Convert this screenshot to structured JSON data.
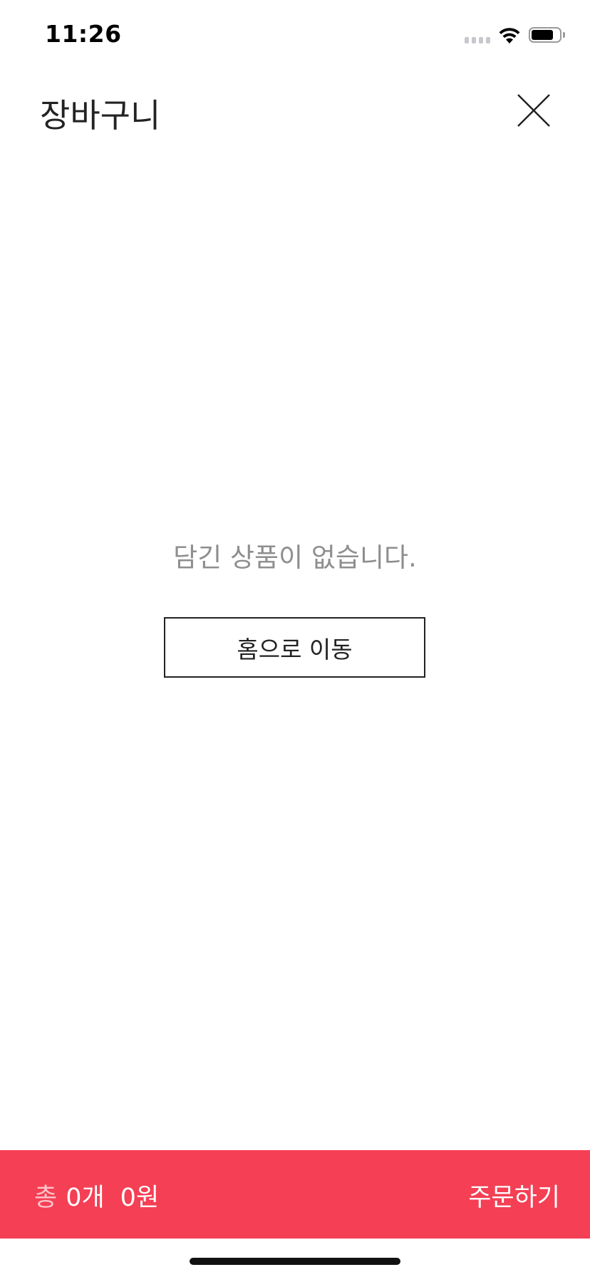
{
  "status_bar": {
    "time": "11:26"
  },
  "header": {
    "title": "장바구니",
    "close_icon": "close-icon"
  },
  "empty_state": {
    "message": "담긴 상품이 없습니다.",
    "home_button_label": "홈으로 이동"
  },
  "order_bar": {
    "total_label": "총",
    "total_count": "0개",
    "total_price": "0원",
    "order_button_label": "주문하기"
  },
  "colors": {
    "accent": "#f43f54",
    "title_text": "#222222",
    "muted_text": "#8e8e8e",
    "total_label_text": "#ffc3cb"
  },
  "device": {
    "battery_level": 0.8
  }
}
